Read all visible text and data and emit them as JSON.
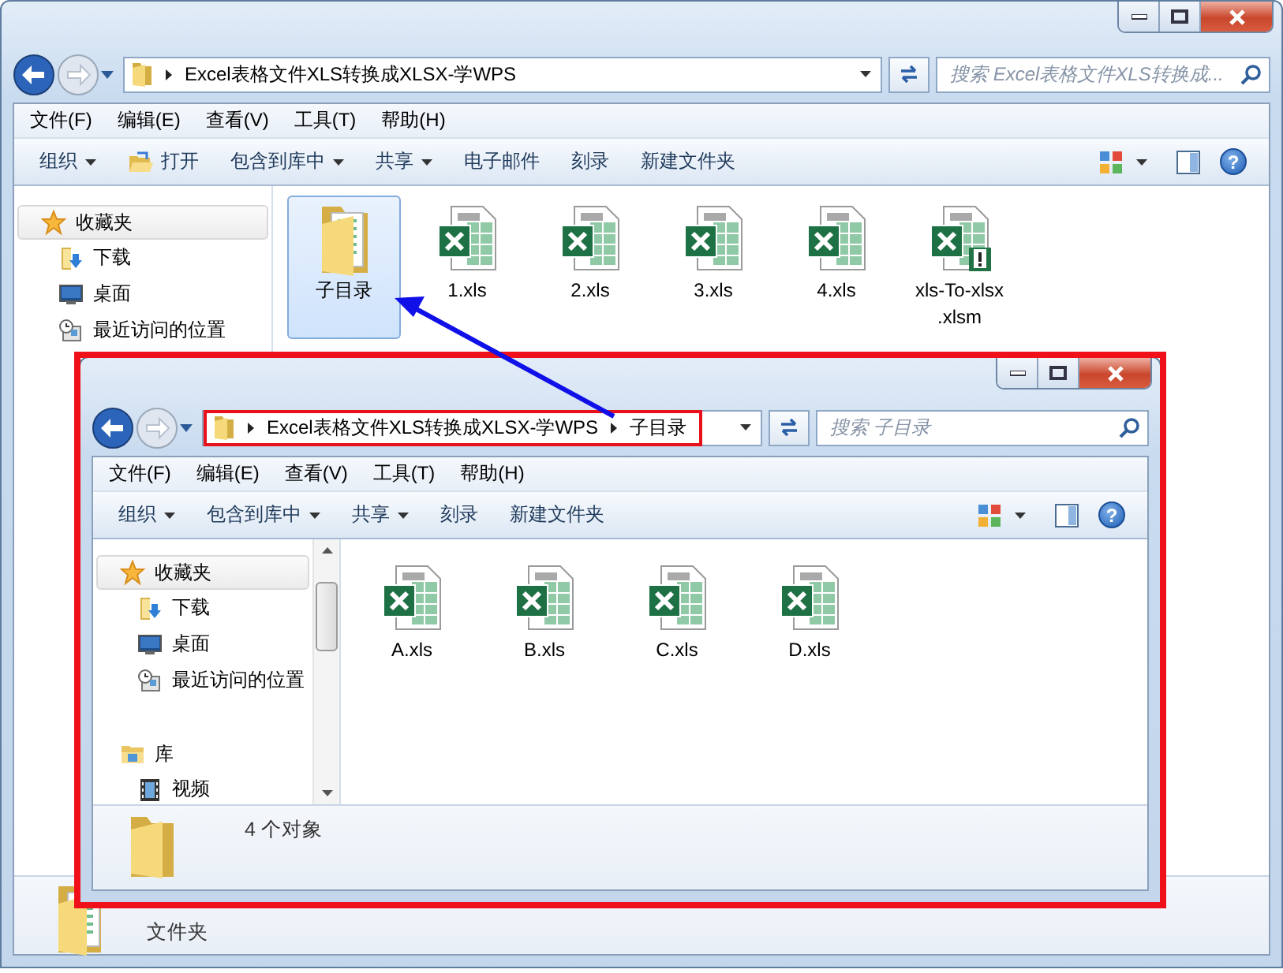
{
  "windows": [
    {
      "address": {
        "crumbs": [
          "Excel表格文件XLS转换成XLSX-学WPS"
        ]
      },
      "search": {
        "placeholder": "搜索 Excel表格文件XLS转换成..."
      },
      "menu": [
        "文件(F)",
        "编辑(E)",
        "查看(V)",
        "工具(T)",
        "帮助(H)"
      ],
      "toolbar": [
        {
          "label": "组织",
          "kind": "dropdown"
        },
        {
          "label": "打开",
          "kind": "open"
        },
        {
          "label": "包含到库中",
          "kind": "dropdown"
        },
        {
          "label": "共享",
          "kind": "dropdown"
        },
        {
          "label": "电子邮件",
          "kind": "plain"
        },
        {
          "label": "刻录",
          "kind": "plain"
        },
        {
          "label": "新建文件夹",
          "kind": "plain"
        }
      ],
      "help": "?",
      "nav": [
        {
          "label": "收藏夹",
          "kind": "star",
          "selected": true,
          "children": [
            {
              "label": "下载",
              "kind": "download"
            },
            {
              "label": "桌面",
              "kind": "desktop"
            },
            {
              "label": "最近访问的位置",
              "kind": "recent"
            }
          ]
        }
      ],
      "files": [
        {
          "name": "子目录",
          "kind": "folder",
          "selected": true
        },
        {
          "name": "1.xls",
          "kind": "xls",
          "selected": false
        },
        {
          "name": "2.xls",
          "kind": "xls",
          "selected": false
        },
        {
          "name": "3.xls",
          "kind": "xls",
          "selected": false
        },
        {
          "name": "4.xls",
          "kind": "xls",
          "selected": false
        },
        {
          "name": "xls-To-xlsx",
          "name_line_2": ".xlsm",
          "kind": "xlsm",
          "selected": false
        }
      ],
      "details": {
        "kind": "folder-with-files",
        "text": "文件夹"
      }
    },
    {
      "address": {
        "crumbs": [
          "Excel表格文件XLS转换成XLSX-学WPS",
          "子目录"
        ],
        "highlighted": true
      },
      "search": {
        "placeholder": "搜索 子目录"
      },
      "menu": [
        "文件(F)",
        "编辑(E)",
        "查看(V)",
        "工具(T)",
        "帮助(H)"
      ],
      "toolbar": [
        {
          "label": "组织",
          "kind": "dropdown"
        },
        {
          "label": "包含到库中",
          "kind": "dropdown"
        },
        {
          "label": "共享",
          "kind": "dropdown"
        },
        {
          "label": "刻录",
          "kind": "plain"
        },
        {
          "label": "新建文件夹",
          "kind": "plain"
        }
      ],
      "help": "?",
      "nav": [
        {
          "label": "收藏夹",
          "kind": "star",
          "selected": true,
          "children": [
            {
              "label": "下载",
              "kind": "download"
            },
            {
              "label": "桌面",
              "kind": "desktop"
            },
            {
              "label": "最近访问的位置",
              "kind": "recent"
            }
          ]
        },
        {
          "label": "库",
          "kind": "library",
          "selected": false,
          "children": [
            {
              "label": "视频",
              "kind": "video"
            }
          ]
        }
      ],
      "nav_scrollable": true,
      "files": [
        {
          "name": "A.xls",
          "kind": "xls",
          "selected": false
        },
        {
          "name": "B.xls",
          "kind": "xls",
          "selected": false
        },
        {
          "name": "C.xls",
          "kind": "xls",
          "selected": false
        },
        {
          "name": "D.xls",
          "kind": "xls",
          "selected": false
        }
      ],
      "details": {
        "kind": "folder",
        "text": "4 个对象"
      },
      "highlighted": true
    }
  ],
  "annotations": [
    {
      "kind": "arrow"
    }
  ]
}
